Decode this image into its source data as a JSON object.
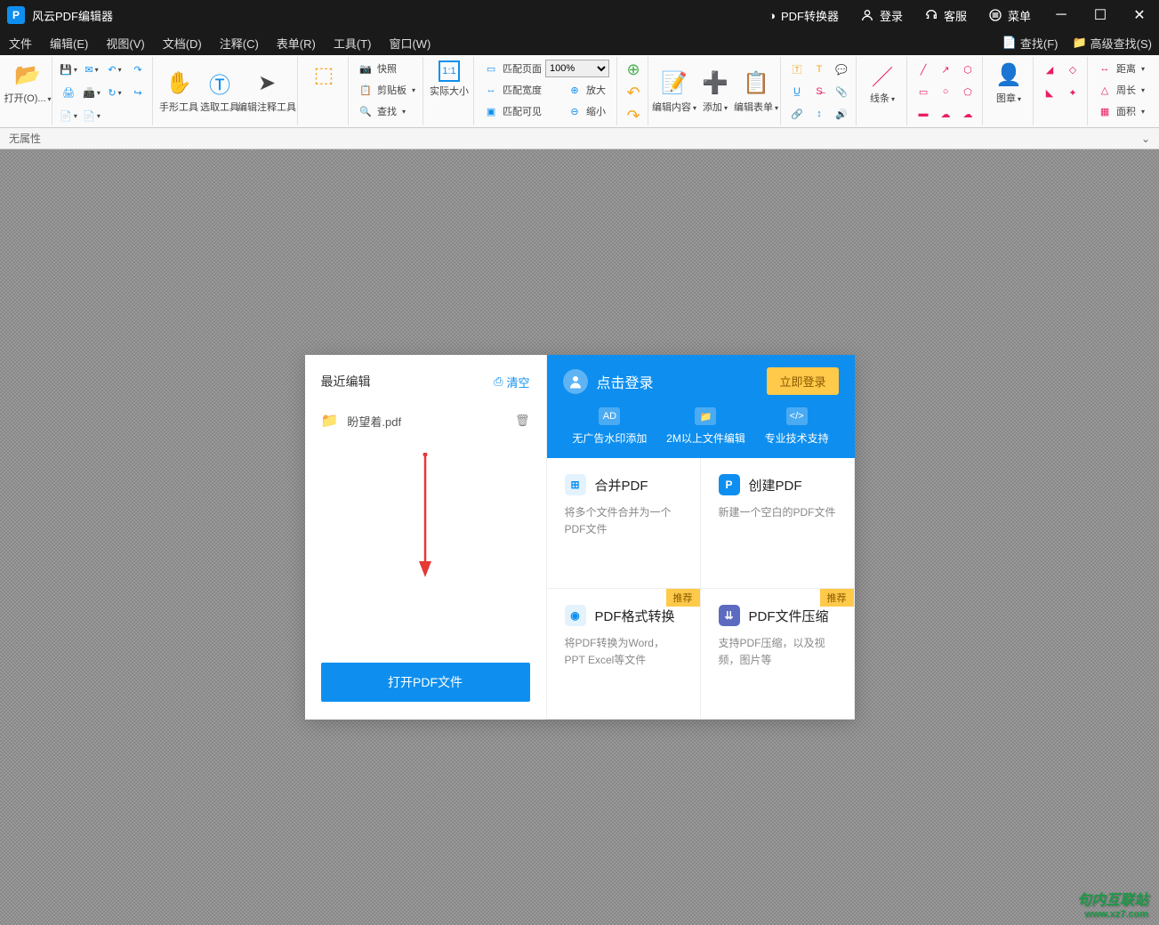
{
  "app": {
    "title": "风云PDF编辑器"
  },
  "titlebar": {
    "converter": "PDF转换器",
    "login": "登录",
    "service": "客服",
    "menu": "菜单"
  },
  "menubar": {
    "file": "文件",
    "edit": "编辑(E)",
    "view": "视图(V)",
    "document": "文档(D)",
    "comment": "注释(C)",
    "form": "表单(R)",
    "tool": "工具(T)",
    "window": "窗口(W)",
    "find": "查找(F)",
    "advfind": "高级查找(S)"
  },
  "ribbon": {
    "open": "打开(O)...",
    "hand": "手形工具",
    "select": "选取工具",
    "annotate": "编辑注释工具",
    "snapshot": "快照",
    "clipboard": "剪贴板",
    "find": "查找",
    "actual": "实际大小",
    "fitpage": "匹配页面",
    "fitwidth": "匹配宽度",
    "fitvisible": "匹配可见",
    "zoomin": "放大",
    "zoomout": "缩小",
    "zoomval": "100%",
    "editcontent": "编辑内容",
    "add": "添加",
    "editform": "编辑表单",
    "lines": "线条",
    "stamp": "图章",
    "distance": "距离",
    "perimeter": "周长",
    "area": "面积"
  },
  "attrbar": {
    "noattr": "无属性"
  },
  "welcome": {
    "recent": "最近编辑",
    "clear": "清空",
    "file1": "盼望着.pdf",
    "openbtn": "打开PDF文件",
    "clicklogin": "点击登录",
    "loginnow": "立即登录",
    "feat1": "无广告水印添加",
    "feat2": "2M以上文件编辑",
    "feat3": "专业技术支持",
    "card1_t": "合并PDF",
    "card1_d": "将多个文件合并为一个PDF文件",
    "card2_t": "创建PDF",
    "card2_d": "新建一个空白的PDF文件",
    "card3_t": "PDF格式转换",
    "card3_d": "将PDF转换为Word，PPT Excel等文件",
    "card4_t": "PDF文件压缩",
    "card4_d": "支持PDF压缩，以及视频，图片等",
    "badge": "推荐"
  },
  "watermark": {
    "main": "句内互联站",
    "sub": "www.xz7.com"
  }
}
